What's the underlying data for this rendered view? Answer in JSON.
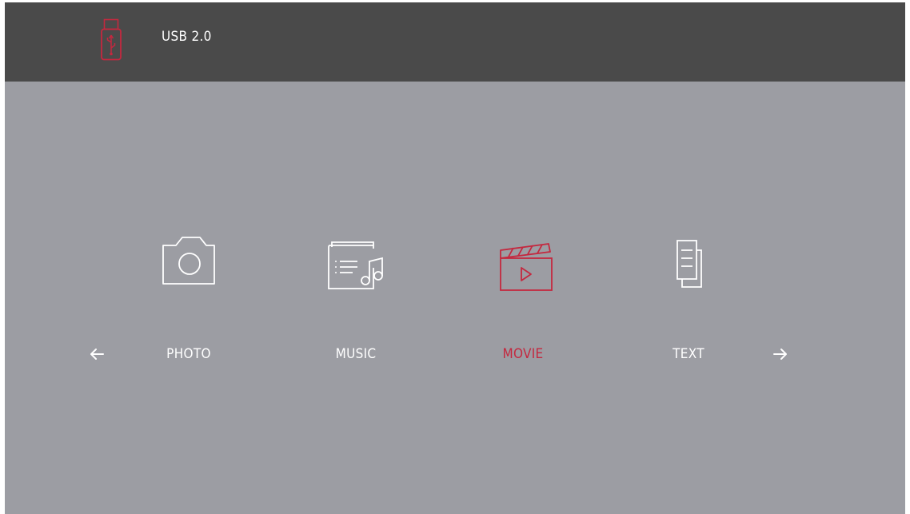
{
  "header": {
    "device_label": "USB 2.0",
    "device_icon": "usb-drive-icon"
  },
  "categories": [
    {
      "label": "PHOTO",
      "icon": "camera-icon",
      "selected": false
    },
    {
      "label": "MUSIC",
      "icon": "music-file-icon",
      "selected": false
    },
    {
      "label": "MOVIE",
      "icon": "clapperboard-icon",
      "selected": true
    },
    {
      "label": "TEXT",
      "icon": "document-icon",
      "selected": false
    }
  ],
  "navigation": {
    "prev_icon": "arrow-left-icon",
    "next_icon": "arrow-right-icon"
  },
  "colors": {
    "background": "#9c9da3",
    "header": "#4a4a4a",
    "accent": "#c4283f",
    "text": "#ffffff"
  }
}
